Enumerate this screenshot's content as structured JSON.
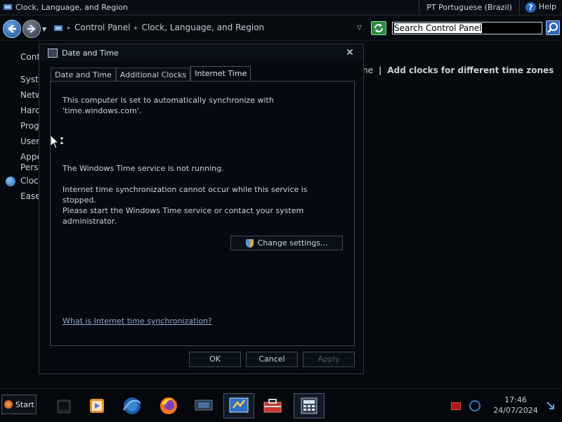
{
  "window": {
    "title": "Clock, Language, and Region",
    "language": "PT Portuguese (Brazil)",
    "help_label": "Help"
  },
  "navbar": {
    "breadcrumb": [
      "Control Panel",
      "Clock, Language, and Region"
    ],
    "search": {
      "value": "Search Control Panel"
    }
  },
  "sidebar": {
    "items": [
      "Cont",
      "Syst",
      "Netw",
      "Hard",
      "Prog",
      "User",
      "Appe",
      "Pers",
      "Clock",
      "Ease"
    ]
  },
  "background": {
    "partial_link": "ne",
    "separator": "|",
    "add_clocks_link": "Add clocks for different time zones"
  },
  "dialog": {
    "title": "Date and Time",
    "tabs": [
      "Date and Time",
      "Additional Clocks",
      "Internet Time"
    ],
    "active_tab": "Internet Time",
    "sync_line1": "This computer is set to automatically synchronize with",
    "sync_line2": "'time.windows.com'.",
    "service_status": "The Windows Time service is not running.",
    "error_line1": "Internet time synchronization cannot occur while this service is stopped.",
    "error_line2": "Please start the Windows Time service or contact your system",
    "error_line3": "administrator.",
    "change_settings_label": "Change settings...",
    "help_link": "What is Internet time synchronization?",
    "ok_label": "OK",
    "cancel_label": "Cancel",
    "apply_label": "Apply"
  },
  "taskbar": {
    "start_label": "Start",
    "apps": [
      "media-device-icon",
      "media-player-icon",
      "internet-explorer-icon",
      "firefox-icon",
      "remote-desktop-icon",
      "control-panel-icon",
      "toolbox-icon",
      "calculator-icon"
    ],
    "time": "17:46",
    "date": "24/07/2024"
  },
  "colors": {
    "background": "#05080c",
    "accent": "#2b64c6",
    "link": "#8fa8c4",
    "disabled_text": "#4a5563"
  }
}
